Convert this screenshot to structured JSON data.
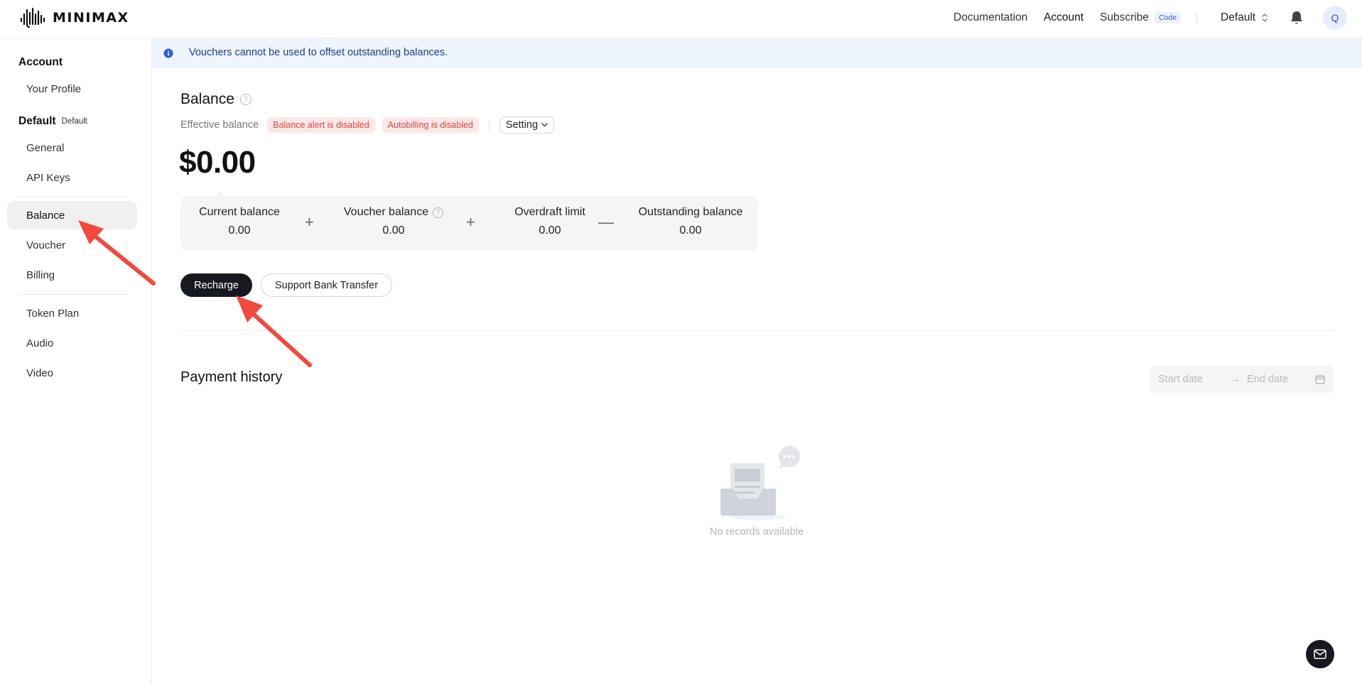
{
  "header": {
    "logo_text": "MINIMAX",
    "nav": {
      "documentation": "Documentation",
      "account": "Account",
      "subscribe": "Subscribe",
      "code_badge": "Code"
    },
    "workspace": "Default",
    "avatar_initial": "Q"
  },
  "sidebar": {
    "account_section": "Account",
    "your_profile": "Your Profile",
    "default_section": "Default",
    "default_tag": "Default",
    "general": "General",
    "api_keys": "API Keys",
    "balance": "Balance",
    "voucher": "Voucher",
    "billing": "Billing",
    "token_plan": "Token Plan",
    "audio": "Audio",
    "video": "Video"
  },
  "banner": {
    "text": "Vouchers cannot be used to offset outstanding balances."
  },
  "balance": {
    "title": "Balance",
    "effective_label": "Effective balance",
    "alert_badge": "Balance alert is disabled",
    "autobilling_badge": "Autobilling is disabled",
    "setting_label": "Setting",
    "amount": "$0.00",
    "breakdown": [
      {
        "label": "Current balance",
        "value": "0.00"
      },
      {
        "label": "Voucher balance",
        "value": "0.00"
      },
      {
        "label": "Overdraft limit",
        "value": "0.00"
      },
      {
        "label": "Outstanding balance",
        "value": "0.00"
      }
    ],
    "operators": [
      "+",
      "+",
      "—"
    ],
    "recharge_label": "Recharge",
    "bank_transfer_label": "Support Bank Transfer"
  },
  "payment_history": {
    "title": "Payment history",
    "start_placeholder": "Start date",
    "end_placeholder": "End date",
    "arrow": "→",
    "empty_text": "No records available"
  },
  "colors": {
    "accent_dark": "#16191f",
    "banner_bg": "#eef5ff",
    "badge_red": "#e0443e",
    "annotation_red": "#f04a3e"
  }
}
